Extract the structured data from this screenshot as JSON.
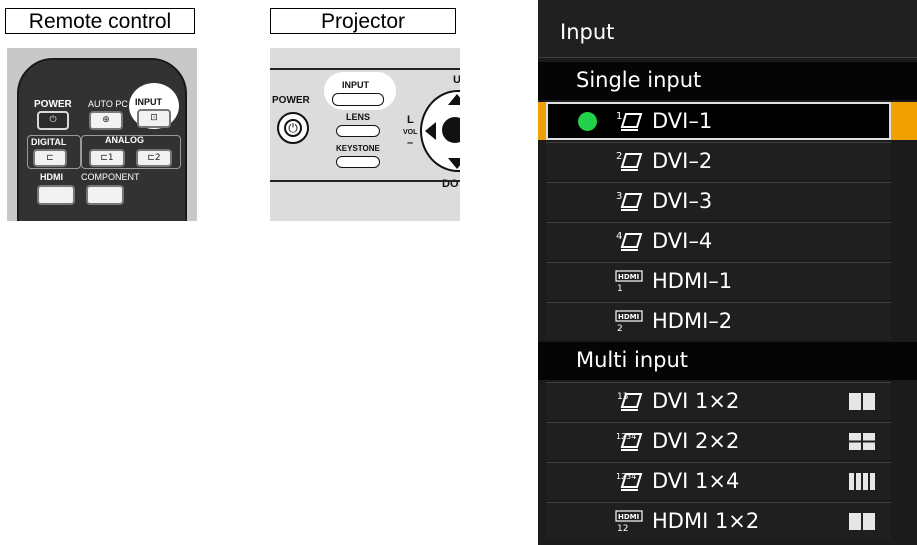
{
  "labels": {
    "remote_control": "Remote control",
    "projector": "Projector"
  },
  "remote": {
    "power": "POWER",
    "auto_pc": "AUTO PC",
    "input": "INPUT",
    "digital": "DIGITAL",
    "analog": "ANALOG",
    "analog_1": "1",
    "analog_2": "2",
    "hdmi": "HDMI",
    "component": "COMPONENT"
  },
  "projector_panel": {
    "power": "POWER",
    "input": "INPUT",
    "lens": "LENS",
    "keystone": "KEYSTONE",
    "l": "L",
    "vol": "VOL",
    "minus": "–",
    "up_partial": "U",
    "down_partial": "DO"
  },
  "osd": {
    "title": "Input",
    "sections": [
      {
        "header": "Single input",
        "items": [
          {
            "label": "DVI–1",
            "icon": "dvi-1-icon",
            "selected": true,
            "active": true
          },
          {
            "label": "DVI–2",
            "icon": "dvi-2-icon"
          },
          {
            "label": "DVI–3",
            "icon": "dvi-3-icon"
          },
          {
            "label": "DVI–4",
            "icon": "dvi-4-icon"
          },
          {
            "label": "HDMI–1",
            "icon": "hdmi-1-icon"
          },
          {
            "label": "HDMI–2",
            "icon": "hdmi-2-icon"
          }
        ]
      },
      {
        "header": "Multi input",
        "items": [
          {
            "label": "DVI 1×2",
            "icon": "dvi-13-icon",
            "layout": "two-column"
          },
          {
            "label": "DVI 2×2",
            "icon": "dvi-1234-icon",
            "layout": "grid-2x2"
          },
          {
            "label": "DVI 1×4",
            "icon": "dvi-1234-icon",
            "layout": "four-column"
          },
          {
            "label": "HDMI 1×2",
            "icon": "hdmi-12-icon",
            "layout": "two-column"
          }
        ]
      }
    ],
    "colors": {
      "selection_accent": "#f0a000",
      "active_dot": "#23d14a",
      "background": "#1b1b1b"
    }
  }
}
